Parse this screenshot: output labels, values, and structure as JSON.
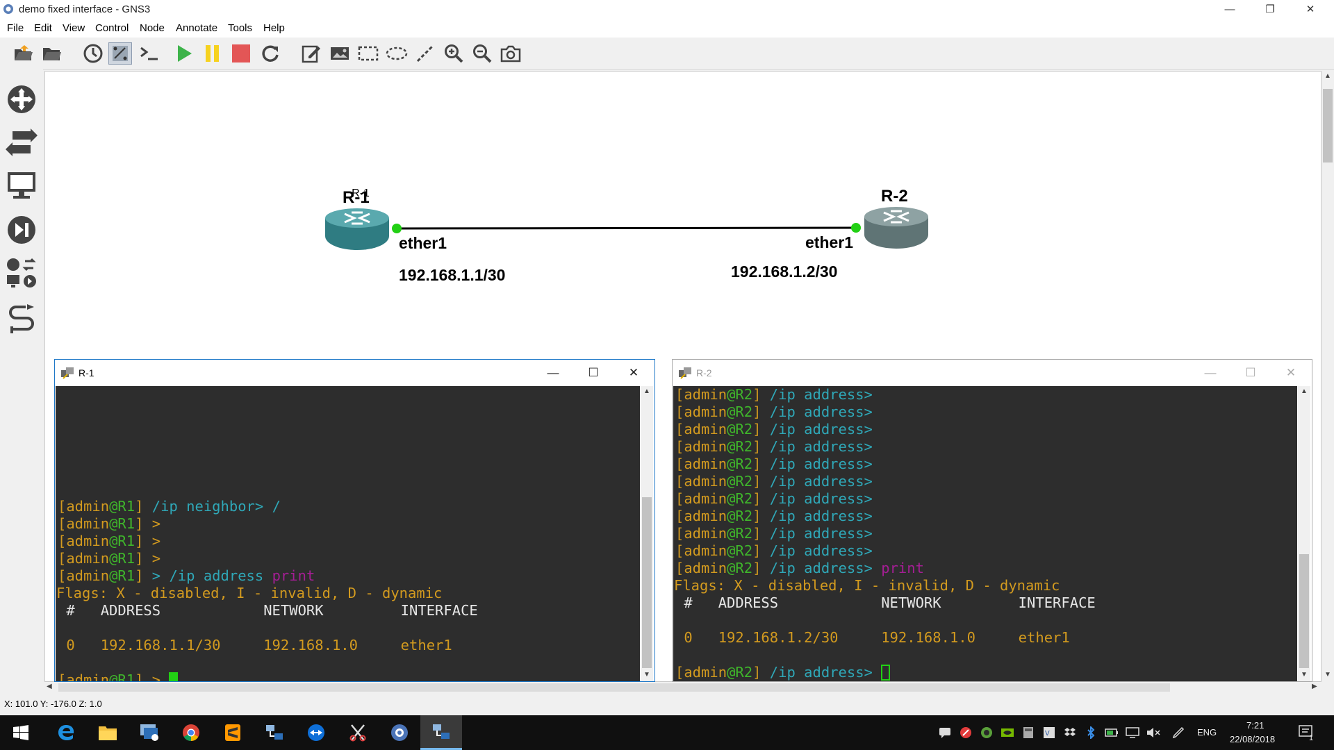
{
  "window": {
    "title": "demo fixed interface - GNS3",
    "controls": {
      "minimize": "—",
      "restore": "❐",
      "close": "✕"
    }
  },
  "menu": [
    "File",
    "Edit",
    "View",
    "Control",
    "Node",
    "Annotate",
    "Tools",
    "Help"
  ],
  "toolbar": {
    "buttons": [
      "open-project",
      "open-file",
      "snapshot",
      "show-interface-labels",
      "console-all",
      "start-all",
      "suspend-all",
      "stop-all",
      "reload-all",
      "add-note",
      "insert-image",
      "draw-rectangle",
      "draw-ellipse",
      "draw-line",
      "zoom-in",
      "zoom-out",
      "screenshot"
    ],
    "active": "show-interface-labels"
  },
  "dock": [
    "routers",
    "switches",
    "end-devices",
    "security-devices",
    "all-devices",
    "add-link"
  ],
  "topology": {
    "nodes": [
      {
        "name": "R-1",
        "interface": "ether1",
        "ip": "192.168.1.1/30",
        "color": "#3d8f95"
      },
      {
        "name": "R-2",
        "interface": "ether1",
        "ip": "192.168.1.2/30",
        "color": "#6f8384"
      }
    ],
    "link_status_color": "#22d014"
  },
  "status": {
    "coords": "X: 101.0 Y: -176.0 Z: 1.0"
  },
  "consoles": {
    "r1": {
      "title": "R-1",
      "lines": [
        {
          "prompt_user": "admin",
          "prompt_host": "R1",
          "path": " /ip neighbor> /",
          "cmd": ""
        },
        {
          "prompt_user": "admin",
          "prompt_host": "R1",
          "path": " >",
          "cmd": ""
        },
        {
          "prompt_user": "admin",
          "prompt_host": "R1",
          "path": " >",
          "cmd": ""
        },
        {
          "prompt_user": "admin",
          "prompt_host": "R1",
          "path": " >",
          "cmd": ""
        },
        {
          "prompt_user": "admin",
          "prompt_host": "R1",
          "path": " > /ip address ",
          "cmd": "print"
        }
      ],
      "flags": "Flags: X - disabled, I - invalid, D - dynamic",
      "header": " #   ADDRESS            NETWORK         INTERFACE",
      "row": " 0   192.168.1.1/30     192.168.1.0     ether1",
      "final_prompt": {
        "prompt_user": "admin",
        "prompt_host": "R1",
        "path": " > "
      }
    },
    "r2": {
      "title": "R-2",
      "lines": [
        {
          "prompt_user": "admin",
          "prompt_host": "R2",
          "path": " /ip address>",
          "cmd": ""
        },
        {
          "prompt_user": "admin",
          "prompt_host": "R2",
          "path": " /ip address>",
          "cmd": ""
        },
        {
          "prompt_user": "admin",
          "prompt_host": "R2",
          "path": " /ip address>",
          "cmd": ""
        },
        {
          "prompt_user": "admin",
          "prompt_host": "R2",
          "path": " /ip address>",
          "cmd": ""
        },
        {
          "prompt_user": "admin",
          "prompt_host": "R2",
          "path": " /ip address>",
          "cmd": ""
        },
        {
          "prompt_user": "admin",
          "prompt_host": "R2",
          "path": " /ip address>",
          "cmd": ""
        },
        {
          "prompt_user": "admin",
          "prompt_host": "R2",
          "path": " /ip address>",
          "cmd": ""
        },
        {
          "prompt_user": "admin",
          "prompt_host": "R2",
          "path": " /ip address>",
          "cmd": ""
        },
        {
          "prompt_user": "admin",
          "prompt_host": "R2",
          "path": " /ip address>",
          "cmd": ""
        },
        {
          "prompt_user": "admin",
          "prompt_host": "R2",
          "path": " /ip address>",
          "cmd": ""
        },
        {
          "prompt_user": "admin",
          "prompt_host": "R2",
          "path": " /ip address> ",
          "cmd": "print"
        }
      ],
      "flags": "Flags: X - disabled, I - invalid, D - dynamic",
      "header": " #   ADDRESS            NETWORK         INTERFACE",
      "row": " 0   192.168.1.2/30     192.168.1.0     ether1",
      "final_prompt": {
        "prompt_user": "admin",
        "prompt_host": "R2",
        "path": " /ip address> "
      }
    }
  },
  "taskbar": {
    "apps": [
      "windows-start",
      "edge",
      "file-explorer",
      "remote-desktop",
      "chrome",
      "sublime-text",
      "network-app",
      "teamviewer",
      "snipping-tool",
      "gns3-pinned",
      "gns3-running"
    ],
    "tray": {
      "language": "ENG",
      "time": "7:21",
      "date": "22/08/2018",
      "notification_count": "1"
    }
  }
}
